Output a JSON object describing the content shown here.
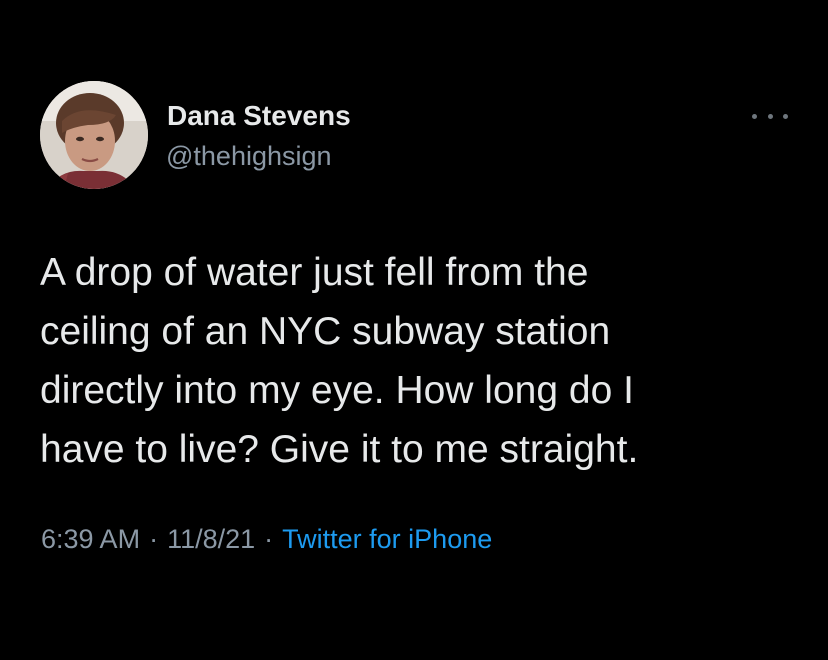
{
  "author": {
    "display_name": "Dana Stevens",
    "handle": "@thehighsign",
    "avatar_alt": "profile photo"
  },
  "tweet": {
    "lines": [
      "A drop of water just fell from the",
      "ceiling of an NYC subway station",
      "directly into my eye. How long do I",
      "have to live? Give it to me straight."
    ]
  },
  "meta": {
    "time": "6:39 AM",
    "separator": "·",
    "date": "11/8/21",
    "source": "Twitter for iPhone"
  },
  "icons": {
    "more": "more-options-icon",
    "avatar": "profile-photo"
  },
  "colors": {
    "background": "#000000",
    "primary_text": "#e7e9ea",
    "secondary_text": "#8b98a5",
    "link": "#1d9bf0"
  }
}
